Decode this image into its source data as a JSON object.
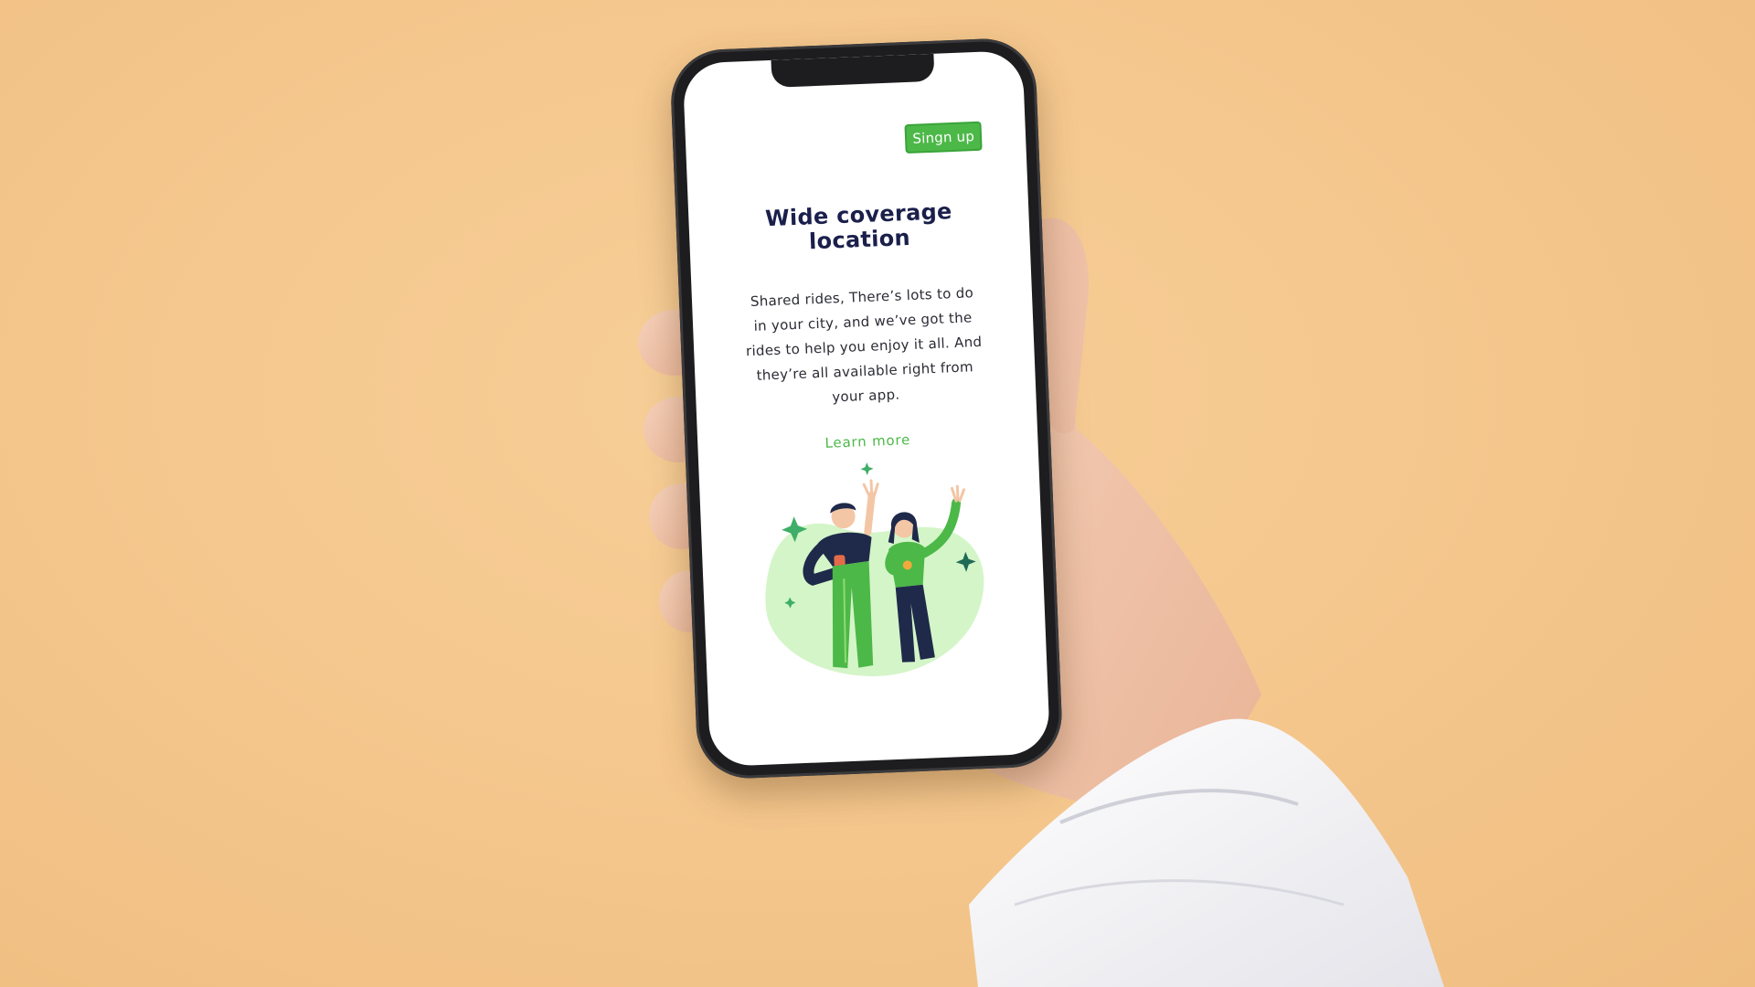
{
  "app": {
    "signup_label": "Singn up",
    "title": "Wide coverage location",
    "description": "Shared rides, There’s lots to do in your city, and we’ve got the rides to help you enjoy it all. And they’re all available right from your app.",
    "learn_more_label": "Learn more"
  },
  "colors": {
    "background": "#f4c68c",
    "accent_green": "#4cb848",
    "title_navy": "#1a1f4b",
    "illustration_blob": "#d4f5c8"
  },
  "icons": {
    "sparkles": "sparkle-icon"
  }
}
